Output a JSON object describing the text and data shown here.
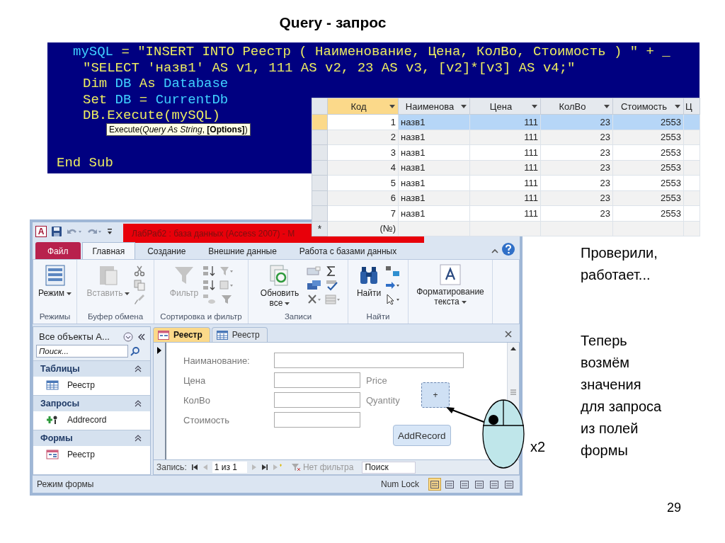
{
  "slide": {
    "title": "Query - запрос",
    "notes": [
      "Проверили, работает...",
      "Теперь возмём значения для запроса из полей формы"
    ],
    "click_label": "x2",
    "page_number": "29"
  },
  "code_editor": {
    "lines": [
      [
        {
          "text": "mySQL",
          "kind": "identifier"
        },
        {
          "text": " = \"INSERT INTO Реестр ( Наименование, Цена, КолВо, Стоимость ) \" + _",
          "kind": "plain"
        }
      ],
      [
        {
          "text": "\"SELECT 'назв1' AS v1, 111 AS v2, 23 AS v3, [v2]*[v3] AS v4;\"",
          "kind": "plain"
        }
      ],
      [
        {
          "text": "Dim ",
          "kind": "plain"
        },
        {
          "text": "DB",
          "kind": "identifier"
        },
        {
          "text": " As ",
          "kind": "plain"
        },
        {
          "text": "Database",
          "kind": "identifier"
        }
      ],
      [
        {
          "text": "Set ",
          "kind": "plain"
        },
        {
          "text": "DB",
          "kind": "identifier"
        },
        {
          "text": " = ",
          "kind": "plain"
        },
        {
          "text": "CurrentDb",
          "kind": "identifier"
        }
      ],
      [
        {
          "text": "DB.Execute(mySQL)",
          "kind": "plain"
        }
      ],
      [
        {
          "text": "End Sub",
          "kind": "plain"
        }
      ]
    ],
    "tooltip": "Execute(*Query As String*, **[Options]**)"
  },
  "table": {
    "columns": [
      {
        "label": "Код",
        "selected": true
      },
      {
        "label": "Наименова",
        "selected": false
      },
      {
        "label": "Цена",
        "selected": false
      },
      {
        "label": "КолВо",
        "selected": false
      },
      {
        "label": "Стоимость",
        "selected": false
      },
      {
        "label": "Ц",
        "selected": false
      }
    ],
    "rows": [
      {
        "cells": [
          "1",
          "назв1",
          "111",
          "23",
          "2553"
        ],
        "selected": true
      },
      {
        "cells": [
          "2",
          "назв1",
          "111",
          "23",
          "2553"
        ],
        "selected": false
      },
      {
        "cells": [
          "3",
          "назв1",
          "111",
          "23",
          "2553"
        ],
        "selected": false
      },
      {
        "cells": [
          "4",
          "назв1",
          "111",
          "23",
          "2553"
        ],
        "selected": false
      },
      {
        "cells": [
          "5",
          "назв1",
          "111",
          "23",
          "2553"
        ],
        "selected": false
      },
      {
        "cells": [
          "6",
          "назв1",
          "111",
          "23",
          "2553"
        ],
        "selected": false
      },
      {
        "cells": [
          "7",
          "назв1",
          "111",
          "23",
          "2553"
        ],
        "selected": false
      }
    ],
    "new_row": {
      "marker": "*",
      "placeholder": "(№)"
    }
  },
  "access_window": {
    "app_badge": "A",
    "title": "ЛабРаб2 : база данных (Access 2007) - М",
    "ribbon_tabs": [
      {
        "label": "Файл",
        "kind": "file",
        "selected": false
      },
      {
        "label": "Главная",
        "kind": "tab",
        "selected": true
      },
      {
        "label": "Создание",
        "kind": "tab",
        "selected": false
      },
      {
        "label": "Внешние данные",
        "kind": "tab",
        "selected": false
      },
      {
        "label": "Работа с базами данных",
        "kind": "tab",
        "selected": false
      }
    ],
    "ribbon_groups": [
      {
        "label": "Режимы",
        "button": {
          "label": "Режим",
          "disabled": false,
          "dropdown": true
        }
      },
      {
        "label": "Буфер обмена",
        "button": {
          "label": "Вставить",
          "disabled": true,
          "dropdown": true
        }
      },
      {
        "label": "Сортировка и фильтр",
        "button": {
          "label": "Фильтр",
          "disabled": true,
          "dropdown": false
        }
      },
      {
        "label": "Записи",
        "button": {
          "label": "Обновить все",
          "disabled": false,
          "dropdown": true
        }
      },
      {
        "label": "Найти",
        "button": {
          "label": "Найти",
          "disabled": false,
          "dropdown": false
        }
      },
      {
        "button": {
          "label": "Форматирование текста",
          "disabled": false,
          "dropdown": true
        }
      }
    ],
    "navigation_pane": {
      "header": "Все объекты A...",
      "search_placeholder": "Поиск...",
      "sections": [
        {
          "title": "Таблицы",
          "kind": "table",
          "items": [
            "Реестр"
          ]
        },
        {
          "title": "Запросы",
          "kind": "query",
          "items": [
            "Addrecord"
          ]
        },
        {
          "title": "Формы",
          "kind": "form",
          "items": [
            "Реестр"
          ]
        }
      ]
    },
    "document_tabs": [
      {
        "label": "Реестр",
        "kind": "form",
        "selected": true
      },
      {
        "label": "Реестр",
        "kind": "table",
        "selected": false
      }
    ],
    "form": {
      "fields": [
        {
          "label": "Наиманование:"
        },
        {
          "label": "Цена",
          "note": "Price"
        },
        {
          "label": "КолВо",
          "note": "Qyantity"
        },
        {
          "label": "Стоимость"
        }
      ],
      "plus_button": "+",
      "add_button": "AddRecord"
    },
    "record_navigator": {
      "label": "Запись:",
      "position": "1 из 1",
      "filter": "Нет фильтра",
      "search_placeholder": "Поиск"
    },
    "status_bar": {
      "mode": "Режим формы",
      "num_lock": "Num Lock",
      "views": [
        {
          "selected": true
        },
        {
          "selected": false
        },
        {
          "selected": false
        },
        {
          "selected": false
        },
        {
          "selected": false
        },
        {
          "selected": false
        }
      ]
    }
  }
}
